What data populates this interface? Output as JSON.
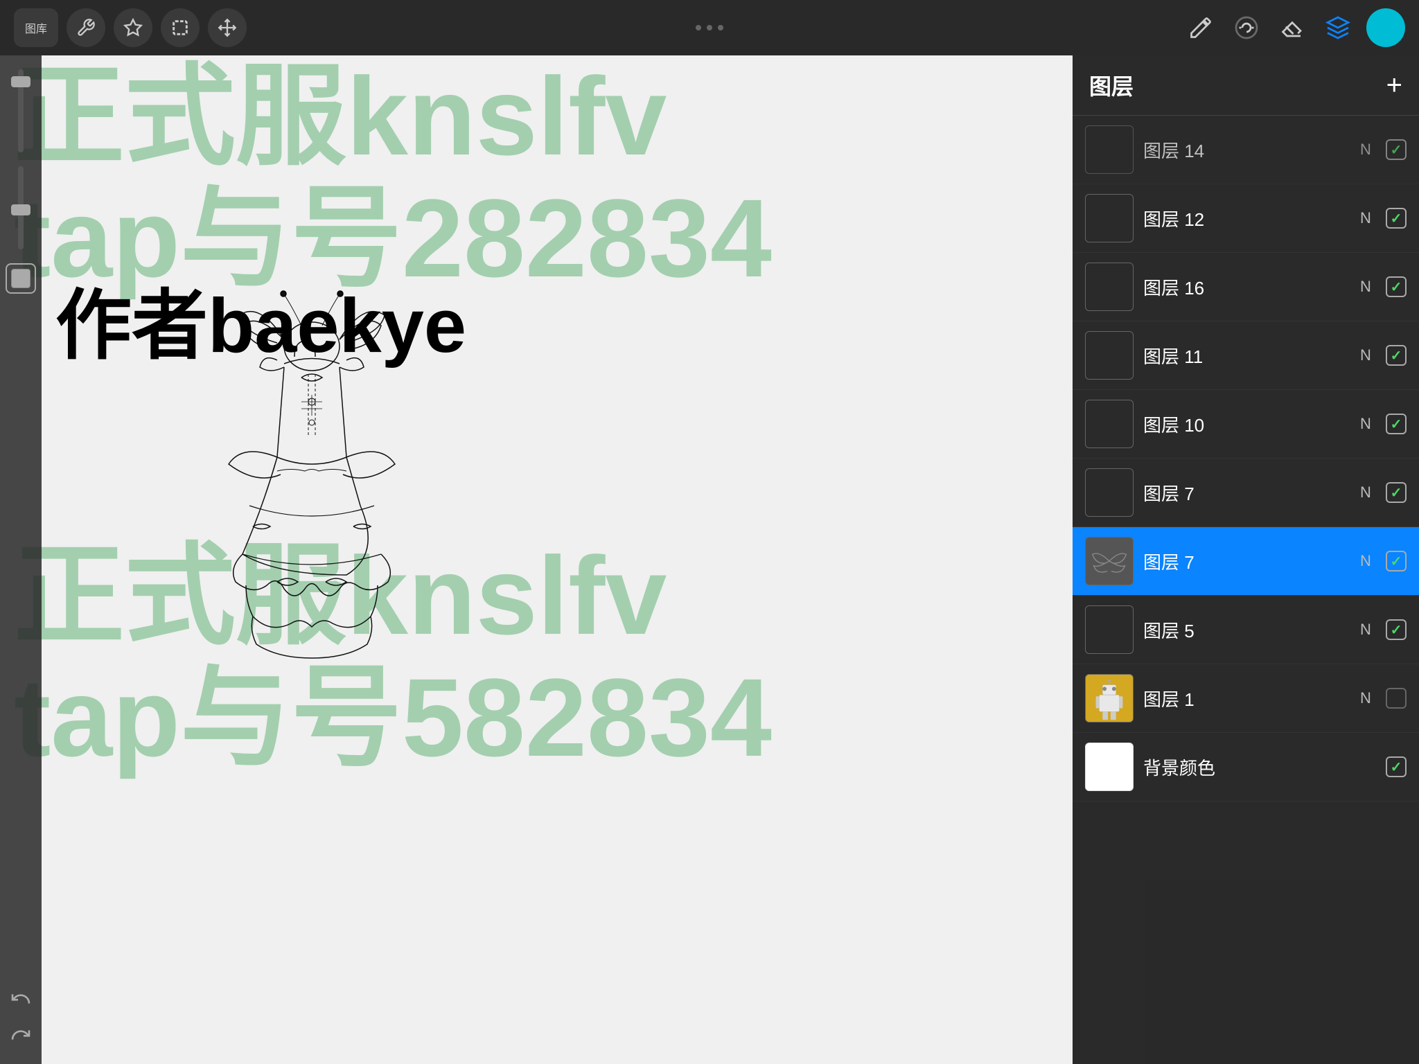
{
  "toolbar": {
    "gallery_label": "图库",
    "dots": [
      "•",
      "•",
      "•"
    ],
    "tools": [
      {
        "name": "wrench",
        "icon": "🔧",
        "active": false
      },
      {
        "name": "magic",
        "icon": "✦",
        "active": false
      },
      {
        "name": "selection",
        "icon": "S",
        "active": false
      },
      {
        "name": "transform",
        "icon": "↗",
        "active": false
      }
    ],
    "right_tools": [
      {
        "name": "brush",
        "icon": "✏",
        "active": false
      },
      {
        "name": "smudge",
        "icon": "✦",
        "active": false
      },
      {
        "name": "eraser",
        "icon": "◻",
        "active": false
      },
      {
        "name": "layers",
        "icon": "layers",
        "active": true
      }
    ]
  },
  "watermarks": [
    {
      "text": "正式服knslfv",
      "size": "large"
    },
    {
      "text": "tap与号282834",
      "size": "large"
    },
    {
      "text": "正式服knslfv",
      "size": "large"
    },
    {
      "text": "tap与号582834",
      "size": "large"
    }
  ],
  "author_text": "作者baekye",
  "layers_panel": {
    "title": "图层",
    "add_button": "+",
    "layers": [
      {
        "id": "14",
        "name": "图层 14",
        "mode": "N",
        "visible": true,
        "thumb_type": "dark",
        "partial": true
      },
      {
        "id": "12",
        "name": "图层 12",
        "mode": "N",
        "visible": true,
        "thumb_type": "dark"
      },
      {
        "id": "16",
        "name": "图层 16",
        "mode": "N",
        "visible": true,
        "thumb_type": "dark"
      },
      {
        "id": "11",
        "name": "图层 11",
        "mode": "N",
        "visible": true,
        "thumb_type": "dark"
      },
      {
        "id": "10",
        "name": "图层 10",
        "mode": "N",
        "visible": true,
        "thumb_type": "dark"
      },
      {
        "id": "7a",
        "name": "图层 7",
        "mode": "N",
        "visible": true,
        "thumb_type": "dark"
      },
      {
        "id": "7b",
        "name": "图层 7",
        "mode": "N",
        "visible": true,
        "thumb_type": "butterfly",
        "selected": true
      },
      {
        "id": "5",
        "name": "图层 5",
        "mode": "N",
        "visible": true,
        "thumb_type": "dark"
      },
      {
        "id": "1",
        "name": "图层 1",
        "mode": "N",
        "visible": false,
        "thumb_type": "robot"
      },
      {
        "id": "bg",
        "name": "背景颜色",
        "mode": "",
        "visible": true,
        "thumb_type": "white"
      }
    ]
  },
  "sidebar": {
    "undo_label": "↺",
    "redo_label": "↻"
  }
}
